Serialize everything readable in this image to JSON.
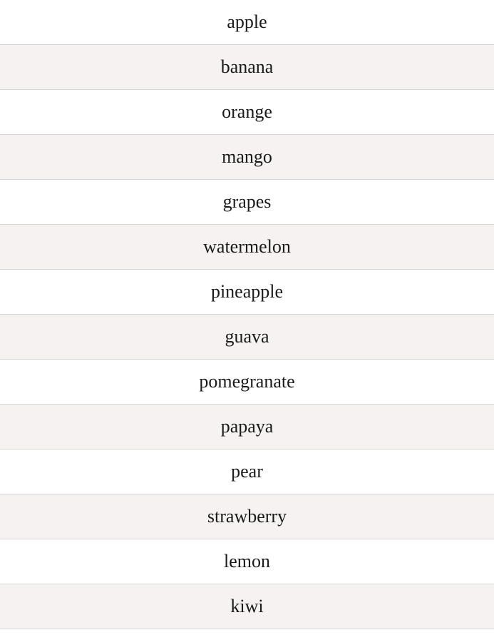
{
  "list": {
    "colors": {
      "row_odd": "#ffffff",
      "row_even": "#f6f2f1",
      "divider": "#d6d6d6",
      "text": "#1a1a1a"
    },
    "items": [
      {
        "label": "apple"
      },
      {
        "label": "banana"
      },
      {
        "label": "orange"
      },
      {
        "label": "mango"
      },
      {
        "label": "grapes"
      },
      {
        "label": "watermelon"
      },
      {
        "label": "pineapple"
      },
      {
        "label": "guava"
      },
      {
        "label": "pomegranate"
      },
      {
        "label": "papaya"
      },
      {
        "label": "pear"
      },
      {
        "label": "strawberry"
      },
      {
        "label": "lemon"
      },
      {
        "label": "kiwi"
      }
    ]
  }
}
